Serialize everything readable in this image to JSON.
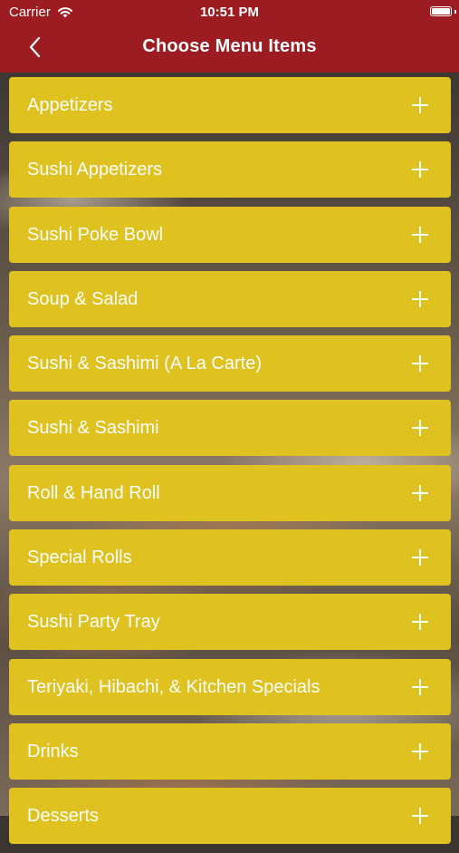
{
  "status_bar": {
    "carrier": "Carrier",
    "time": "10:51 PM",
    "wifi_icon": "wifi-icon",
    "battery_icon": "battery-icon"
  },
  "nav": {
    "back_icon": "chevron-left-icon",
    "title": "Choose Menu Items"
  },
  "colors": {
    "header": "#9c1c22",
    "item_background": "#dfc21f",
    "item_text": "#ffffff"
  },
  "menu": {
    "expand_icon": "plus-icon",
    "items": [
      {
        "label": "Appetizers"
      },
      {
        "label": "Sushi Appetizers"
      },
      {
        "label": "Sushi Poke Bowl"
      },
      {
        "label": "Soup & Salad"
      },
      {
        "label": "Sushi & Sashimi (A La Carte)"
      },
      {
        "label": "Sushi & Sashimi"
      },
      {
        "label": "Roll & Hand Roll"
      },
      {
        "label": "Special Rolls"
      },
      {
        "label": "Sushi Party Tray"
      },
      {
        "label": "Teriyaki, Hibachi, & Kitchen Specials"
      },
      {
        "label": "Drinks"
      },
      {
        "label": "Desserts"
      }
    ]
  }
}
